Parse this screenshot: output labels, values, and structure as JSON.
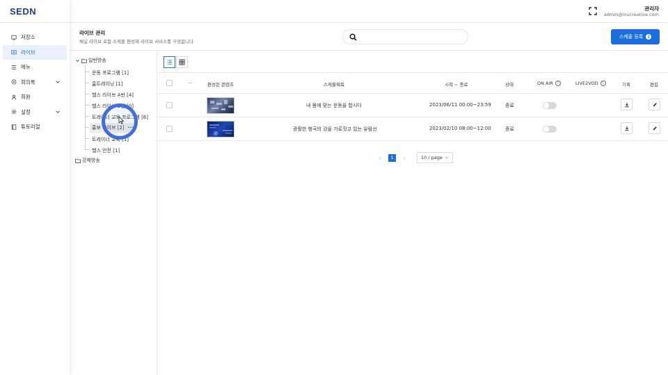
{
  "brand": {
    "logo": "SEDN",
    "accent": "#1a6ee0"
  },
  "sidebar": {
    "items": [
      {
        "label": "저장소",
        "icon": "storage-icon",
        "active": false,
        "expandable": false
      },
      {
        "label": "라이브",
        "icon": "live-icon",
        "active": true,
        "expandable": false
      },
      {
        "label": "메뉴",
        "icon": "menu-icon",
        "active": false,
        "expandable": false
      },
      {
        "label": "회의록",
        "icon": "minutes-icon",
        "active": false,
        "expandable": true
      },
      {
        "label": "회원",
        "icon": "user-icon",
        "active": false,
        "expandable": false
      },
      {
        "label": "설정",
        "icon": "gear-icon",
        "active": false,
        "expandable": true
      },
      {
        "label": "튜토리얼",
        "icon": "book-icon",
        "active": false,
        "expandable": false
      }
    ]
  },
  "header": {
    "user_name": "관리자",
    "user_email": "admin@inucreative.com"
  },
  "titlebar": {
    "title": "라이브 관리",
    "subtitle": "채널 라이브 포함 스케줄 편성해 라이브 서비스를 구성합니다",
    "search_placeholder": "",
    "register_label": "스케줄 등록"
  },
  "tree": {
    "root1": "일반방송",
    "children": [
      "운동 프로그램 [1]",
      "홈트레이닝 [1]",
      "헬스 라이브 A반 [4]",
      "헬스 라이브 B반 [0]",
      "트레이너 교육 프로그램 [6]",
      "홍보 라이브 [2]",
      "트레이너 교육 [1]",
      "헬스 안전 [1]"
    ],
    "selected_index": 5,
    "more": "···",
    "root2": "강제방송"
  },
  "table": {
    "headers": {
      "more": "···",
      "content": "편성된 콘텐츠",
      "title": "스케줄제목",
      "time": "시작 ~ 종료",
      "status": "상태",
      "onair": "ON AIR",
      "live2vod": "LIVE2VOD",
      "record": "기록",
      "edit": "편집"
    },
    "rows": [
      {
        "title": "내 몸에 맞는 운동을 합시다",
        "time": "2023/06/11 00:00~23:59",
        "status": "종료",
        "onair": false
      },
      {
        "title": "광활한 행국의 강을 가로짓고 있는 유람선",
        "time": "2023/02/10 08:00~12:00",
        "status": "종료",
        "onair": false
      }
    ]
  },
  "pagination": {
    "current": "1",
    "page_size": "10 / page",
    "prev": "‹",
    "next": "›"
  }
}
